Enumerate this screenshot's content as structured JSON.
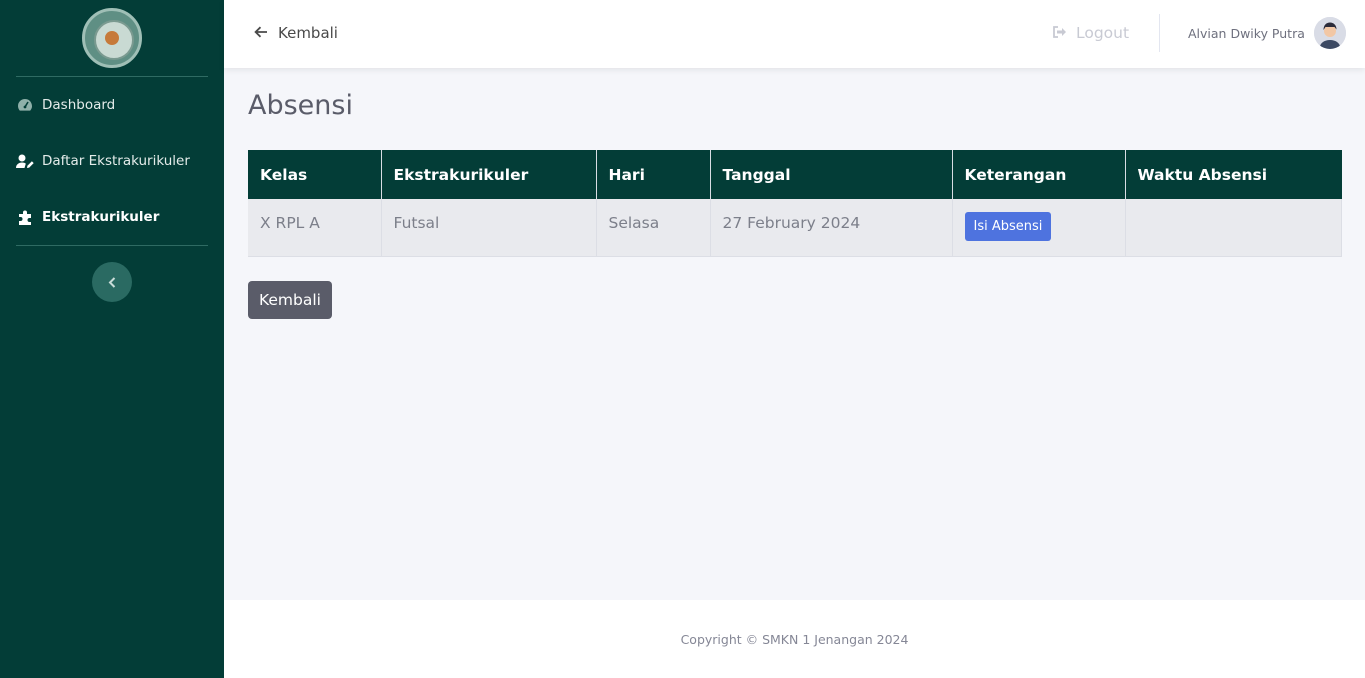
{
  "sidebar": {
    "items": [
      {
        "label": "Dashboard",
        "icon": "tachometer-icon"
      },
      {
        "label": "Daftar Ekstrakurikuler",
        "icon": "user-edit-icon"
      },
      {
        "label": "Ekstrakurikuler",
        "icon": "puzzle-icon"
      }
    ],
    "toggle_icon": "chevron-left-icon"
  },
  "topbar": {
    "back_label": "Kembali",
    "logout_label": "Logout",
    "user_name": "Alvian Dwiky Putra"
  },
  "main": {
    "title": "Absensi",
    "table": {
      "headers": [
        "Kelas",
        "Ekstrakurikuler",
        "Hari",
        "Tanggal",
        "Keterangan",
        "Waktu Absensi"
      ],
      "rows": [
        {
          "kelas": "X RPL A",
          "ekstrakurikuler": "Futsal",
          "hari": "Selasa",
          "tanggal": "27 February 2024",
          "action_label": "Isi Absensi",
          "waktu": ""
        }
      ]
    },
    "back_button": "Kembali"
  },
  "footer": {
    "copyright": "Copyright © SMKN 1 Jenangan 2024"
  },
  "colors": {
    "sidebar": "#033d37",
    "primary": "#4e73df",
    "secondary": "#5a5c69"
  }
}
